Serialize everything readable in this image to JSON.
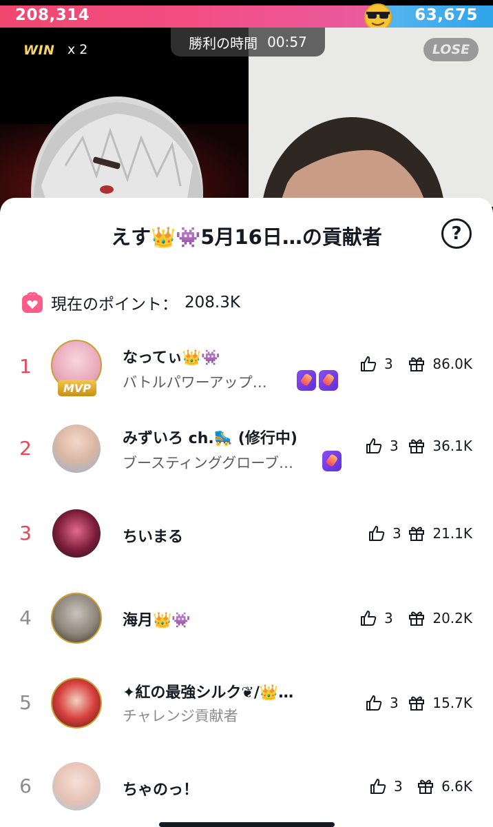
{
  "battle": {
    "left_score": "208,314",
    "right_score": "63,675",
    "win_label": "WIN",
    "win_multiplier": "x 2",
    "timer_label": "勝利の時間",
    "timer_value": "00:57",
    "lose_label": "LOSE"
  },
  "panel": {
    "title": "えす👑👾5月16日…の貢献者",
    "help_icon": "question-circle-icon",
    "points_label": "現在のポイント：",
    "points_value": "208.3K"
  },
  "contributors": [
    {
      "rank": "1",
      "name": "なってぃ👑👾",
      "subtitle": "バトルパワーアップ…",
      "likes": "3",
      "gifts": "86.0K",
      "mvp": "MVP"
    },
    {
      "rank": "2",
      "name": "みずいろ ch.🛼 (修行中)",
      "subtitle": "ブースティンググローブ…",
      "likes": "3",
      "gifts": "36.1K"
    },
    {
      "rank": "3",
      "name": "ちいまる",
      "likes": "3",
      "gifts": "21.1K"
    },
    {
      "rank": "4",
      "name": "海月👑👾",
      "likes": "3",
      "gifts": "20.2K"
    },
    {
      "rank": "5",
      "name": "✦紅の最強シルク❦/👑…",
      "subtitle": "チャレンジ貢献者",
      "likes": "3",
      "gifts": "15.7K"
    },
    {
      "rank": "6",
      "name": "ちゃのっ！",
      "likes": "3",
      "gifts": "6.6K"
    }
  ],
  "colors": {
    "left_team": "#f0476f",
    "right_team": "#2fa3ea",
    "rank_top": "#e8445a",
    "rank_other": "#8a8a8f"
  }
}
